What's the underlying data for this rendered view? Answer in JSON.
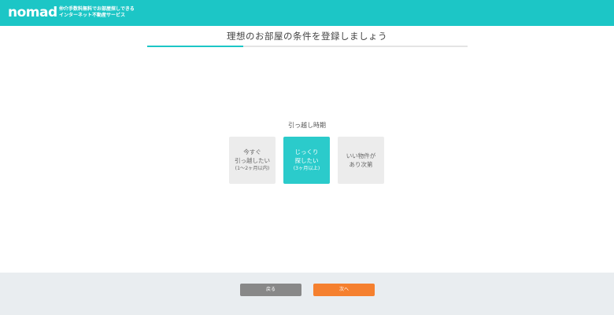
{
  "header": {
    "logo_text": "nomad",
    "tagline_line1": "仲介手数料無料でお部屋探しできる",
    "tagline_line2": "インターネット不動産サービス",
    "color": "#1cc6c6"
  },
  "page_title": "理想のお部屋の条件を登録しましょう",
  "progress": {
    "fraction": 0.3
  },
  "question": "引っ越し時期",
  "options": [
    {
      "line1": "今すぐ",
      "line2": "引っ越したい",
      "note": "(1〜2ヶ月以内)",
      "selected": false
    },
    {
      "line1": "じっくり",
      "line2": "探したい",
      "note": "(3ヶ月以上)",
      "selected": true
    },
    {
      "line1": "いい物件が",
      "line2": "あり次第",
      "note": "",
      "selected": false
    }
  ],
  "footer": {
    "back_label": "戻る",
    "next_label": "次へ",
    "next_color": "#f5802f"
  }
}
